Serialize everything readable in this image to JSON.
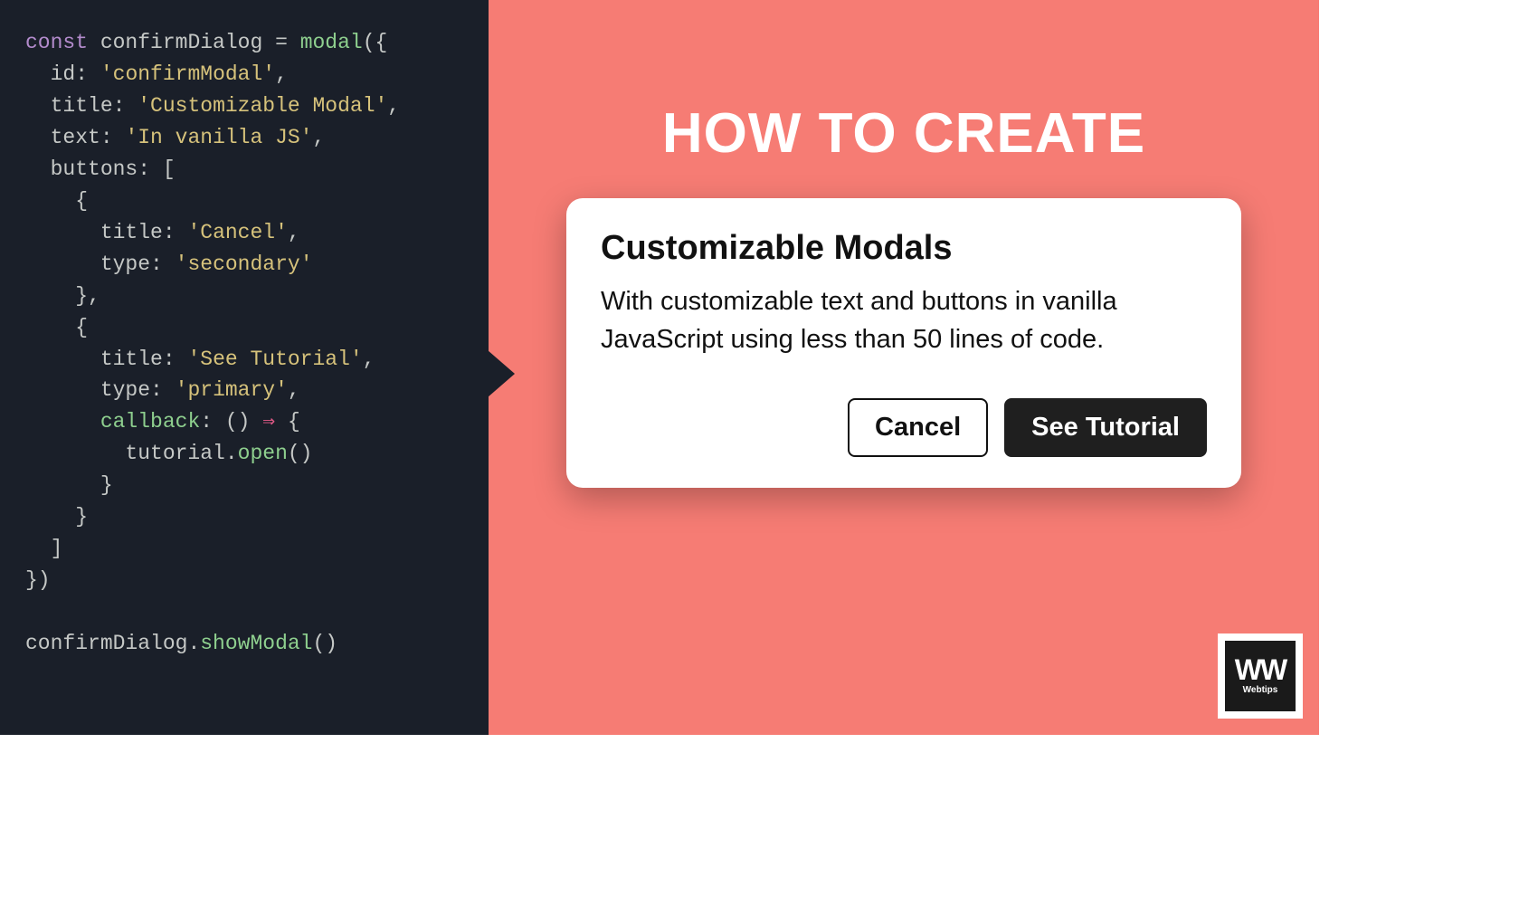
{
  "code": {
    "line1": {
      "kw": "const",
      "var": "confirmDialog",
      "eq": "=",
      "fn": "modal",
      "open": "({"
    },
    "line2": {
      "prop": "id",
      "colon": ":",
      "str": "'confirmModal'",
      "comma": ","
    },
    "line3": {
      "prop": "title",
      "colon": ":",
      "str": "'Customizable Modal'",
      "comma": ","
    },
    "line4": {
      "prop": "text",
      "colon": ":",
      "str": "'In vanilla JS'",
      "comma": ","
    },
    "line5": {
      "prop": "buttons",
      "colon": ":",
      "bracket": "["
    },
    "line6": {
      "brace": "{"
    },
    "line7": {
      "prop": "title",
      "colon": ":",
      "str": "'Cancel'",
      "comma": ","
    },
    "line8": {
      "prop": "type",
      "colon": ":",
      "str": "'secondary'"
    },
    "line9": {
      "brace": "},",
      "nothing": ""
    },
    "line10": {
      "brace": "{"
    },
    "line11": {
      "prop": "title",
      "colon": ":",
      "str": "'See Tutorial'",
      "comma": ","
    },
    "line12": {
      "prop": "type",
      "colon": ":",
      "str": "'primary'",
      "comma": ","
    },
    "line13": {
      "prop": "callback",
      "colon": ":",
      "paren": "()",
      "arrow": "⇒",
      "brace": "{"
    },
    "line14": {
      "obj": "tutorial",
      "dot": ".",
      "fn": "open",
      "paren": "()"
    },
    "line15": {
      "brace": "}"
    },
    "line16": {
      "brace": "}"
    },
    "line17": {
      "bracket": "]"
    },
    "line18": {
      "close": "})"
    },
    "line20": {
      "var": "confirmDialog",
      "dot": ".",
      "fn": "showModal",
      "paren": "()"
    }
  },
  "preview": {
    "heading": "HOW TO CREATE",
    "modal": {
      "title": "Customizable Modals",
      "text": "With customizable text and buttons in vanilla JavaScript using less than 50 lines of code.",
      "cancel": "Cancel",
      "primary": "See Tutorial"
    }
  },
  "logo": {
    "mark": "WW",
    "text": "Webtips"
  }
}
